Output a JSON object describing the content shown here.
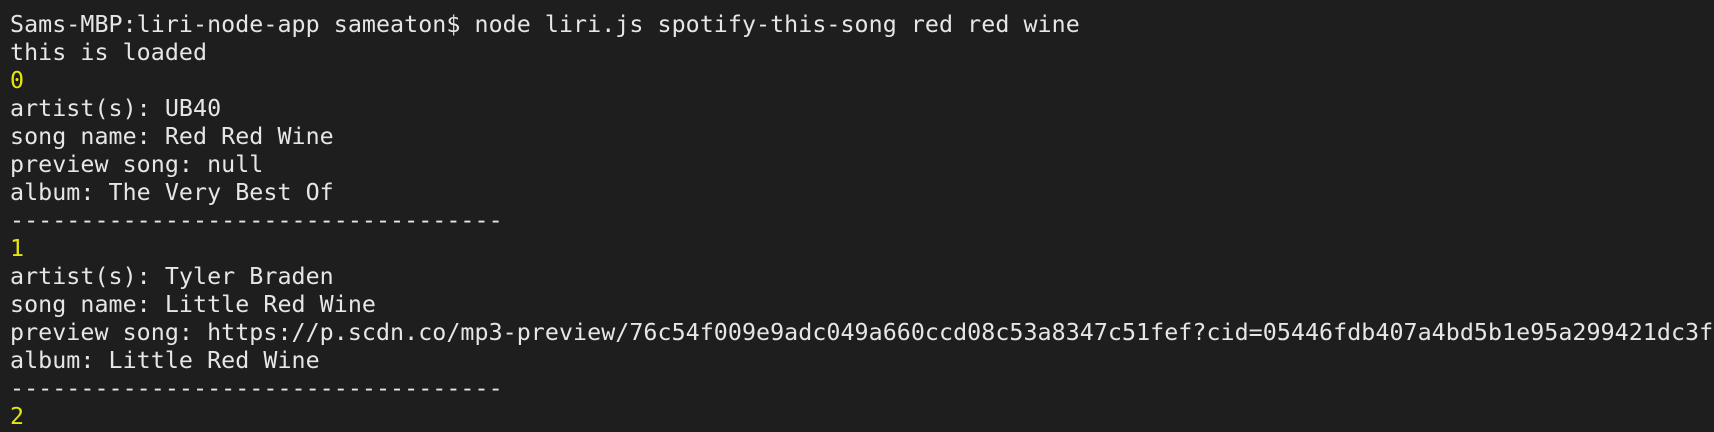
{
  "terminal": {
    "command_line": "Sams-MBP:liri-node-app sameaton$ node liri.js spotify-this-song red red wine",
    "loaded_message": "this is loaded",
    "separator": "-----------------------------------",
    "results": [
      {
        "index": "0",
        "artist_line": "artist(s): UB40",
        "song_line": "song name: Red Red Wine",
        "preview_line": "preview song: null",
        "album_line": "album: The Very Best Of"
      },
      {
        "index": "1",
        "artist_line": "artist(s): Tyler Braden",
        "song_line": "song name: Little Red Wine",
        "preview_line": "preview song: https://p.scdn.co/mp3-preview/76c54f009e9adc049a660ccd08c53a8347c51fef?cid=05446fdb407a4bd5b1e95a299421dc3f",
        "album_line": "album: Little Red Wine"
      },
      {
        "index": "2"
      }
    ],
    "colors": {
      "background": "#1e1e1e",
      "text": "#e6e6e6",
      "index_number": "#e5e510"
    }
  }
}
